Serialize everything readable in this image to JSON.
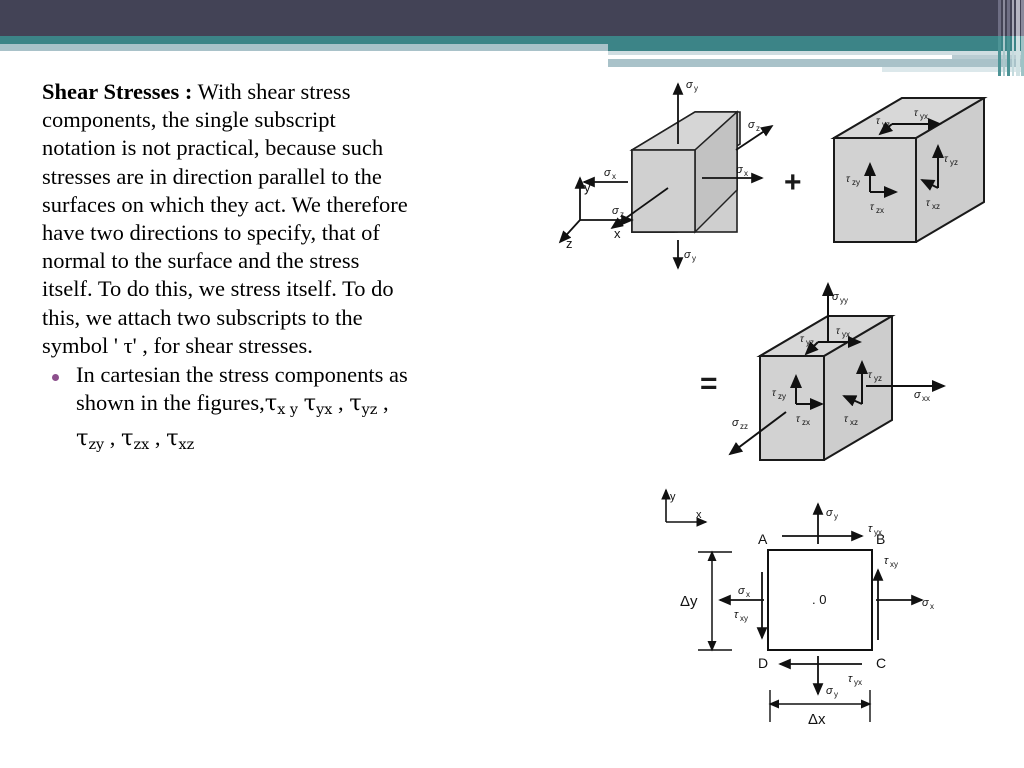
{
  "slide": {
    "theme": {
      "dark_bar": "#434356",
      "teal_bar": "#3c8487",
      "light_blue_bar": "#a9c2c9",
      "pale_bar": "#cfdde1",
      "bullet_color": "#8c4f8c"
    }
  },
  "content": {
    "heading": "Shear Stresses :",
    "paragraph": "With shear stress components, the single subscript notation is not practical, because such stresses are in direction parallel to the surfaces on which they act. We therefore have two directions to specify, that of normal to the surface and the stress itself. To do this, we stress itself. To do this, we attach two subscripts to the symbol ' τ' , for shear stresses.",
    "bullet": {
      "text_before": "In cartesian   the stress components as shown in the figures,",
      "components": [
        {
          "symbol": "τ",
          "sub": "x y"
        },
        {
          "symbol": "τ",
          "sub": "yx"
        },
        {
          "symbol": "τ",
          "sub": "yz"
        },
        {
          "symbol": "τ",
          "sub": "zy"
        },
        {
          "symbol": "τ",
          "sub": "zx"
        },
        {
          "symbol": "τ",
          "sub": "xz"
        }
      ],
      "separator": " , "
    }
  },
  "figures": {
    "operators": {
      "plus": "+",
      "equals": "="
    },
    "fig1": {
      "name": "normal-stress-cube",
      "axes": {
        "y": "y",
        "x": "x",
        "z": "z"
      },
      "labels": {
        "top": "σy",
        "bottom": "σy",
        "left": "σx",
        "right": "σx",
        "back": "σz",
        "front": "σz"
      }
    },
    "fig2": {
      "name": "shear-stress-cube",
      "labels": {
        "top_right": "τyx",
        "top_left": "τyz",
        "left_up": "τzy",
        "left_right": "τzx",
        "right_up": "τyz",
        "right_left": "τxz"
      }
    },
    "fig3": {
      "name": "combined-stress-cube",
      "labels": {
        "sigma_yy": "σyy",
        "sigma_xx": "σxx",
        "sigma_zz": "σzz",
        "tau_yx": "τyx",
        "tau_yz_top": "τyz",
        "tau_zy": "τzy",
        "tau_zx": "τzx",
        "tau_yz_right": "τyz",
        "tau_xz": "τxz"
      }
    },
    "fig4": {
      "name": "two-dimensional-stress-element",
      "axes": {
        "y": "y",
        "x": "x"
      },
      "corners": {
        "a": "A",
        "b": "B",
        "c": "C",
        "d": "D"
      },
      "center": ". 0",
      "dimensions": {
        "width": "Δx",
        "height": "Δy"
      },
      "labels": {
        "sigma_y_top": "σy",
        "sigma_y_bottom": "σy",
        "sigma_x_left": "σx",
        "sigma_x_right": "σx",
        "tau_yx_top": "τyx",
        "tau_yx_bottom": "τyx",
        "tau_xy_left": "τxy",
        "tau_xy_right": "τxy"
      }
    }
  }
}
